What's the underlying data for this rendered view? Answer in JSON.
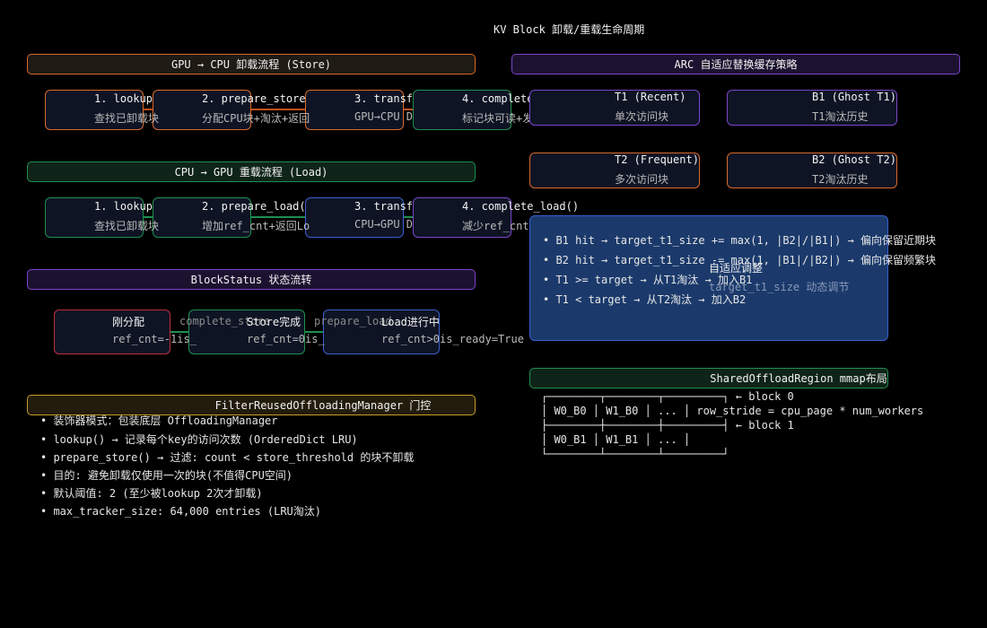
{
  "title": "KV Block 卸载/重载生命周期",
  "store": {
    "header": "GPU → CPU 卸载流程 (Store)",
    "steps": [
      {
        "name": "1. lookup",
        "desc": "查找已卸载块"
      },
      {
        "name": "2. prepare_store",
        "desc": "分配CPU块+淘汰+返回"
      },
      {
        "name": "3. transf",
        "desc": "GPU→CPU D"
      },
      {
        "name": "4. complete",
        "desc": "标记块可读+发"
      }
    ]
  },
  "load": {
    "header": "CPU → GPU 重载流程 (Load)",
    "steps": [
      {
        "name": "1. lookup",
        "desc": "查找已卸载块"
      },
      {
        "name": "2. prepare_load(",
        "desc": "增加ref_cnt+返回Lo"
      },
      {
        "name": "3. transf",
        "desc": "CPU→GPU D"
      },
      {
        "name": "4. complete_load()",
        "desc": "减少ref_cnt"
      }
    ]
  },
  "status": {
    "header": "BlockStatus 状态流转",
    "states": [
      {
        "name": "刚分配",
        "desc": "ref_cnt=-1is_"
      },
      {
        "name": "Store完成",
        "desc": "ref_cnt=0is_"
      },
      {
        "name": "Load进行中",
        "desc": "ref_cnt>0is_ready=True"
      }
    ],
    "transitions": [
      "complete_store",
      "prepare_load"
    ]
  },
  "filter": {
    "header": "FilterReusedOffloadingManager 门控",
    "bullets": [
      "装饰器模式：包装底层 OffloadingManager",
      "lookup() → 记录每个key的访问次数 (OrderedDict LRU)",
      "prepare_store() → 过滤: count < store_threshold 的块不卸载",
      "目的: 避免卸载仅使用一次的块(不值得CPU空间)",
      "默认阈值: 2 (至少被lookup 2次才卸载)",
      "max_tracker_size: 64,000 entries (LRU淘汰)"
    ]
  },
  "arc": {
    "header": "ARC 自适应替换缓存策略",
    "lists": [
      {
        "name": "T1 (Recent)",
        "desc": "单次访问块"
      },
      {
        "name": "B1 (Ghost T1)",
        "desc": "T1淘汰历史"
      },
      {
        "name": "T2 (Frequent)",
        "desc": "多次访问块"
      },
      {
        "name": "B2 (Ghost T2)",
        "desc": "T2淘汰历史"
      }
    ],
    "rules": [
      "B1 hit → target_t1_size += max(1, |B2|/|B1|) → 偏向保留近期块",
      "B2 hit → target_t1_size -= max(1, |B1|/|B2|) → 偏向保留频繁块",
      "T1 >= target → 从T1淘汰 → 加入B1",
      "T1 < target → 从T2淘汰 → 加入B2"
    ],
    "adapt_title": "自适应调整",
    "adapt_desc": "target_t1_size 动态调节"
  },
  "mmap": {
    "header": "SharedOffloadRegion mmap布局",
    "lines": [
      "┌────────┬────────┬─────────┐ ← block 0",
      "│ W0_B0 │ W1_B0 │ ... │ row_stride = cpu_page * num_workers",
      "├────────┼────────┼─────────┤ ← block 1",
      "│ W0_B1 │ W1_B1 │ ... │",
      "└────────┴────────┴─────────┘"
    ]
  },
  "colors": {
    "orange": "#d9692a",
    "green": "#1f8f4f",
    "purple": "#7a45c9",
    "blue": "#3a5fd0",
    "red": "#c0303a",
    "gold": "#c99a2a",
    "panel": "#1b3a6b"
  }
}
